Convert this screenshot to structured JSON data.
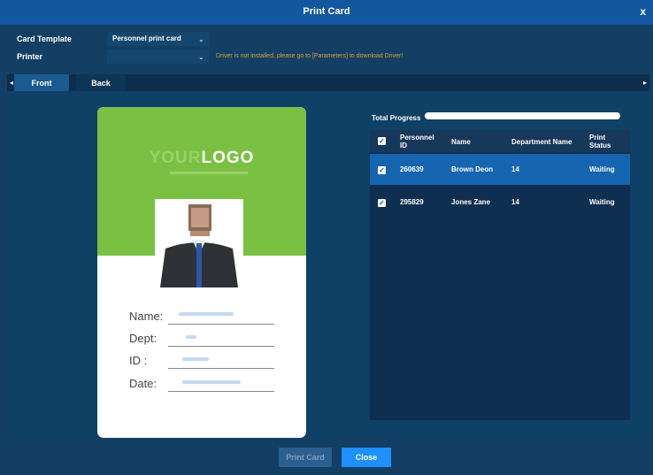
{
  "window": {
    "title": "Print Card",
    "close_glyph": "x"
  },
  "form": {
    "card_template_label": "Card Template",
    "card_template_value": "Personnel print card",
    "printer_label": "Printer",
    "printer_value": "",
    "warning": "Driver is not installed, please go to [Parameters] to download Driver!"
  },
  "tabs": [
    {
      "label": "Front",
      "active": true
    },
    {
      "label": "Back",
      "active": false
    }
  ],
  "card": {
    "logo_part1": "YOUR",
    "logo_part2": "LOGO",
    "fields": [
      "Name:",
      "Dept:",
      "ID    :",
      "Date:"
    ]
  },
  "progress": {
    "label": "Total Progress",
    "value": 0
  },
  "table": {
    "columns": [
      "Personnel ID",
      "Name",
      "Department Name",
      "Print Status"
    ],
    "rows": [
      {
        "id": "260639",
        "name": "Brown Deon",
        "dept": "14",
        "status": "Waiting",
        "checked": true,
        "selected": true
      },
      {
        "id": "295829",
        "name": "Jones Zane",
        "dept": "14",
        "status": "Waiting",
        "checked": true,
        "selected": false
      }
    ]
  },
  "buttons": {
    "print": "Print Card",
    "close": "Close"
  },
  "colors": {
    "accent": "#1e90ff",
    "header": "#1357a0",
    "card_green": "#7ac143",
    "warning": "#e0a040"
  }
}
